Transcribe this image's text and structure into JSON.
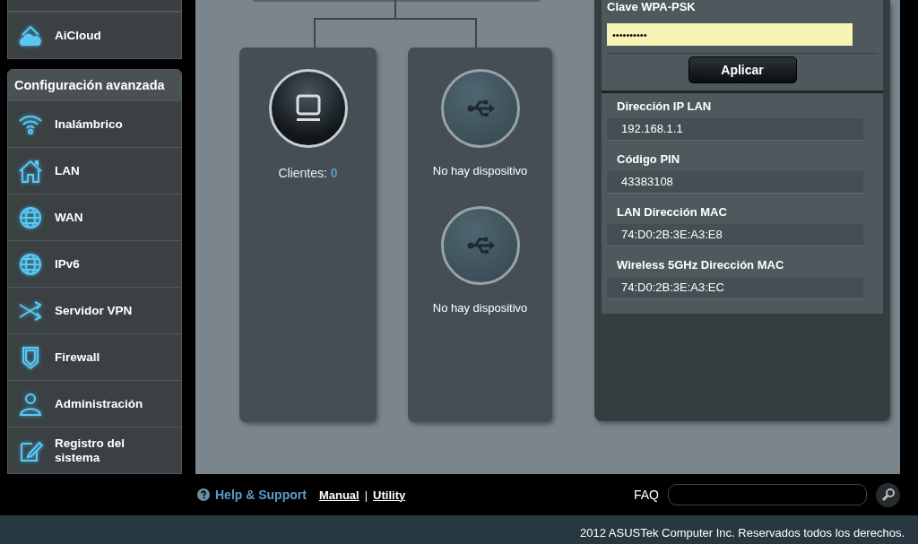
{
  "sidebar": {
    "items": [
      {
        "label": "AiCloud",
        "kind": "cloud"
      }
    ]
  },
  "advanced": {
    "title": "Configuración avanzada",
    "items": [
      {
        "label": "Inalámbrico",
        "kind": "wifi"
      },
      {
        "label": "LAN",
        "kind": "house"
      },
      {
        "label": "WAN",
        "kind": "globe"
      },
      {
        "label": "IPv6",
        "kind": "ipv6"
      },
      {
        "label": "Servidor VPN",
        "kind": "vpn"
      },
      {
        "label": "Firewall",
        "kind": "shield"
      },
      {
        "label": "Administración",
        "kind": "person"
      },
      {
        "label": "Registro del sistema",
        "kind": "edit"
      }
    ]
  },
  "clients_card": {
    "label": "Clientes:",
    "count": "0"
  },
  "usb_card": {
    "ports": [
      {
        "status": "No hay dispositivo"
      },
      {
        "status": "No hay dispositivo"
      }
    ]
  },
  "wireless_panel": {
    "key_label": "Clave WPA-PSK",
    "key_value": "••••••••••",
    "apply_button": "Aplicar",
    "info": [
      {
        "label": "Dirección IP LAN",
        "value": "192.168.1.1"
      },
      {
        "label": "Código PIN",
        "value": "43383108"
      },
      {
        "label": "LAN Dirección MAC",
        "value": "74:D0:2B:3E:A3:E8"
      },
      {
        "label": "Wireless 5GHz Dirección MAC",
        "value": "74:D0:2B:3E:A3:EC"
      }
    ]
  },
  "footer": {
    "help": "Help & Support",
    "links": [
      "Manual",
      "Utility"
    ],
    "separator": "|",
    "faq_label": "FAQ"
  },
  "copyright": "2012 ASUSTek Computer Inc. Reservados todos los derechos."
}
